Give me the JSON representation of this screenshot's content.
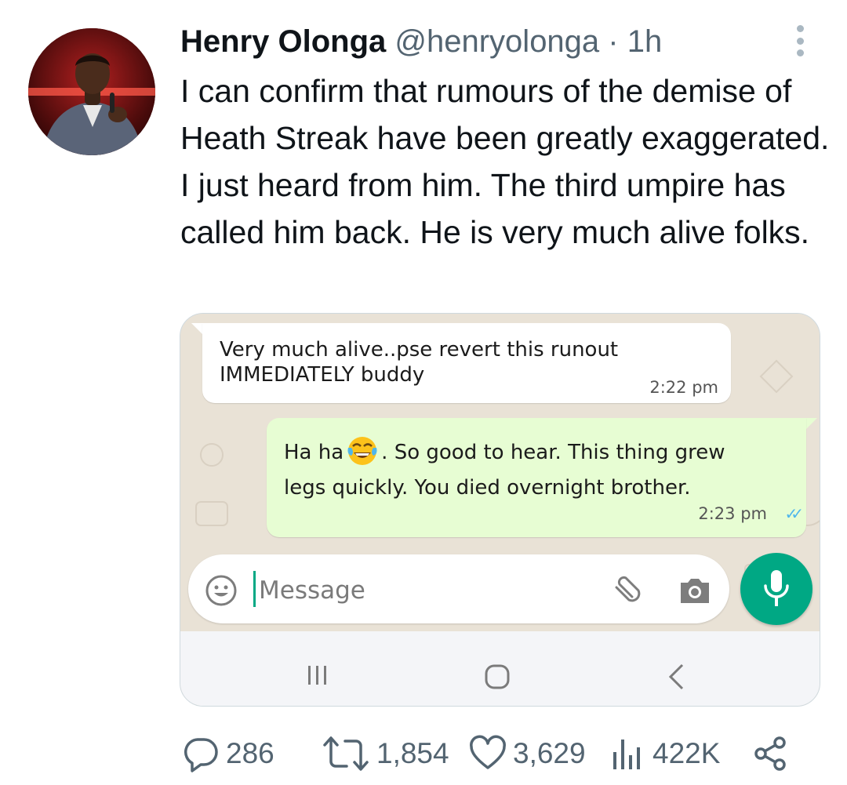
{
  "tweet": {
    "author_name": "Henry Olonga",
    "handle": "@henryolonga",
    "separator": "·",
    "time": "1h",
    "text": "I can confirm that rumours of the demise of Heath Streak have been greatly exaggerated.  I just heard from him. The third umpire has called him back. He is very much alive folks."
  },
  "screenshot": {
    "incoming": {
      "line1": "Very much alive..pse revert this runout",
      "line2": "IMMEDIATELY buddy",
      "time": "2:22 pm"
    },
    "outgoing": {
      "prefix": "Ha ha",
      "emoji": "face-with-tears-of-joy",
      "line1_rest": ". So good to hear. This thing grew",
      "line2": "legs quickly. You died overnight brother.",
      "time": "2:23 pm",
      "status": "read"
    },
    "composer": {
      "placeholder": "Message"
    },
    "colors": {
      "chat_bg": "#e9e2d6",
      "outgoing_bubble": "#e7fdd3",
      "accent_green": "#00a884",
      "read_ticks": "#4fb6ec"
    }
  },
  "actions": {
    "replies": "286",
    "retweets": "1,854",
    "likes": "3,629",
    "views": "422K"
  }
}
